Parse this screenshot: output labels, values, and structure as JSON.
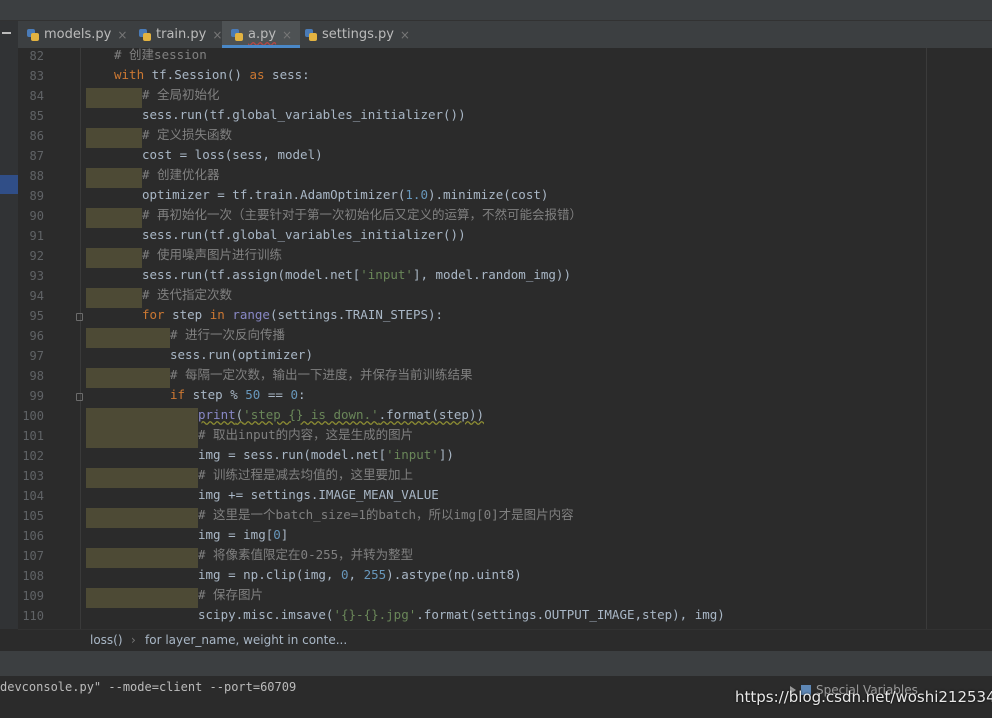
{
  "tabs": [
    {
      "label": "models.py"
    },
    {
      "label": "train.py"
    },
    {
      "label": "a.py"
    },
    {
      "label": "settings.py"
    }
  ],
  "close_glyph": "×",
  "lines": [
    {
      "n": "82"
    },
    {
      "n": "83"
    },
    {
      "n": "84"
    },
    {
      "n": "85"
    },
    {
      "n": "86"
    },
    {
      "n": "87"
    },
    {
      "n": "88"
    },
    {
      "n": "89"
    },
    {
      "n": "90"
    },
    {
      "n": "91"
    },
    {
      "n": "92"
    },
    {
      "n": "93"
    },
    {
      "n": "94"
    },
    {
      "n": "95"
    },
    {
      "n": "96"
    },
    {
      "n": "97"
    },
    {
      "n": "98"
    },
    {
      "n": "99"
    },
    {
      "n": "100"
    },
    {
      "n": "101"
    },
    {
      "n": "102"
    },
    {
      "n": "103"
    },
    {
      "n": "104"
    },
    {
      "n": "105"
    },
    {
      "n": "106"
    },
    {
      "n": "107"
    },
    {
      "n": "108"
    },
    {
      "n": "109"
    },
    {
      "n": "110"
    }
  ],
  "code": {
    "l82": "# 创建session",
    "l83_with": "with",
    "l83_rest": " tf.Session() ",
    "l83_as": "as",
    "l83_end": " sess:",
    "l84": "# 全局初始化",
    "l85": "sess.run(tf.global_variables_initializer())",
    "l86": "# 定义损失函数",
    "l87": "cost = loss(sess, model)",
    "l88": "# 创建优化器",
    "l89_a": "optimizer = tf.train.AdamOptimizer(",
    "l89_num": "1.0",
    "l89_b": ").minimize(cost)",
    "l90": "# 再初始化一次（主要针对于第一次初始化后又定义的运算，不然可能会报错）",
    "l91": "sess.run(tf.global_variables_initializer())",
    "l92": "# 使用噪声图片进行训练",
    "l93_a": "sess.run(tf.assign(model.net[",
    "l93_s": "'input'",
    "l93_b": "], model.random_img))",
    "l94": "# 迭代指定次数",
    "l95_for": "for",
    "l95_a": " step ",
    "l95_in": "in",
    "l95_sp": " ",
    "l95_range": "range",
    "l95_b": "(settings.TRAIN_STEPS):",
    "l96": "# 进行一次反向传播",
    "l97": "sess.run(optimizer)",
    "l98": "# 每隔一定次数，输出一下进度，并保存当前训练结果",
    "l99_if": "if",
    "l99_a": " step % ",
    "l99_n1": "50",
    "l99_b": " == ",
    "l99_n2": "0",
    "l99_c": ":",
    "l100_print": "print",
    "l100_a": "(",
    "l100_s": "'step {} is down.'",
    "l100_b": ".format(step))",
    "l101": "# 取出input的内容，这是生成的图片",
    "l102_a": "img = sess.run(model.net[",
    "l102_s": "'input'",
    "l102_b": "])",
    "l103": "# 训练过程是减去均值的，这里要加上",
    "l104": "img += settings.IMAGE_MEAN_VALUE",
    "l105": "# 这里是一个batch_size=1的batch，所以img[0]才是图片内容",
    "l106_a": "img = img[",
    "l106_n": "0",
    "l106_b": "]",
    "l107": "# 将像素值限定在0-255，并转为整型",
    "l108_a": "img = np.clip(img, ",
    "l108_n1": "0",
    "l108_b": ", ",
    "l108_n2": "255",
    "l108_c": ").astype(np.uint8)",
    "l109": "# 保存图片",
    "l110_a": "scipy.misc.imsave(",
    "l110_s": "'{}-{}.jpg'",
    "l110_b": ".format(settings.OUTPUT_IMAGE,step), img)"
  },
  "breadcrumb": {
    "item1": "loss()",
    "sep": "›",
    "item2": "for layer_name, weight in conte..."
  },
  "console": {
    "command": "devconsole.py\" --mode=client --port=60709",
    "special_label": "Special Variables"
  },
  "watermark": "https://blog.csdn.net/woshi212534",
  "colors": {
    "background": "#2b2b2b",
    "keyword": "#cc7832",
    "comment": "#808080",
    "string": "#6a8759",
    "number": "#6897bb",
    "indent_highlight": "#4d4a35"
  }
}
